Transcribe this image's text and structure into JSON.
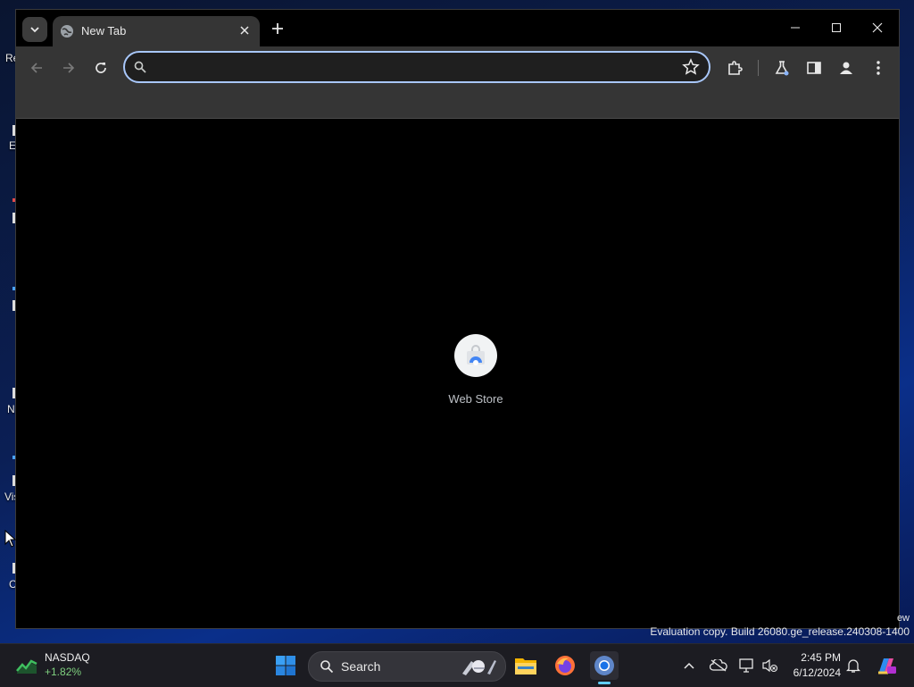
{
  "desktop": {
    "labels": [
      "Re",
      "E",
      "N",
      "Vis",
      "C"
    ]
  },
  "browser": {
    "tab": {
      "title": "New Tab"
    },
    "omnibox": {
      "value": "",
      "placeholder": ""
    },
    "shortcuts": [
      {
        "label": "Web Store"
      }
    ]
  },
  "watermark": {
    "partial": "ew",
    "build": "Evaluation copy. Build 26080.ge_release.240308-1400"
  },
  "taskbar": {
    "widget": {
      "title": "NASDAQ",
      "change": "+1.82%"
    },
    "search_label": "Search",
    "clock": {
      "time": "2:45 PM",
      "date": "6/12/2024"
    }
  },
  "colors": {
    "accent": "#a8c7fa",
    "toolbar": "#353535",
    "page_bg": "#000000",
    "taskbar": "#1c1c22",
    "positive": "#7fd17f"
  }
}
